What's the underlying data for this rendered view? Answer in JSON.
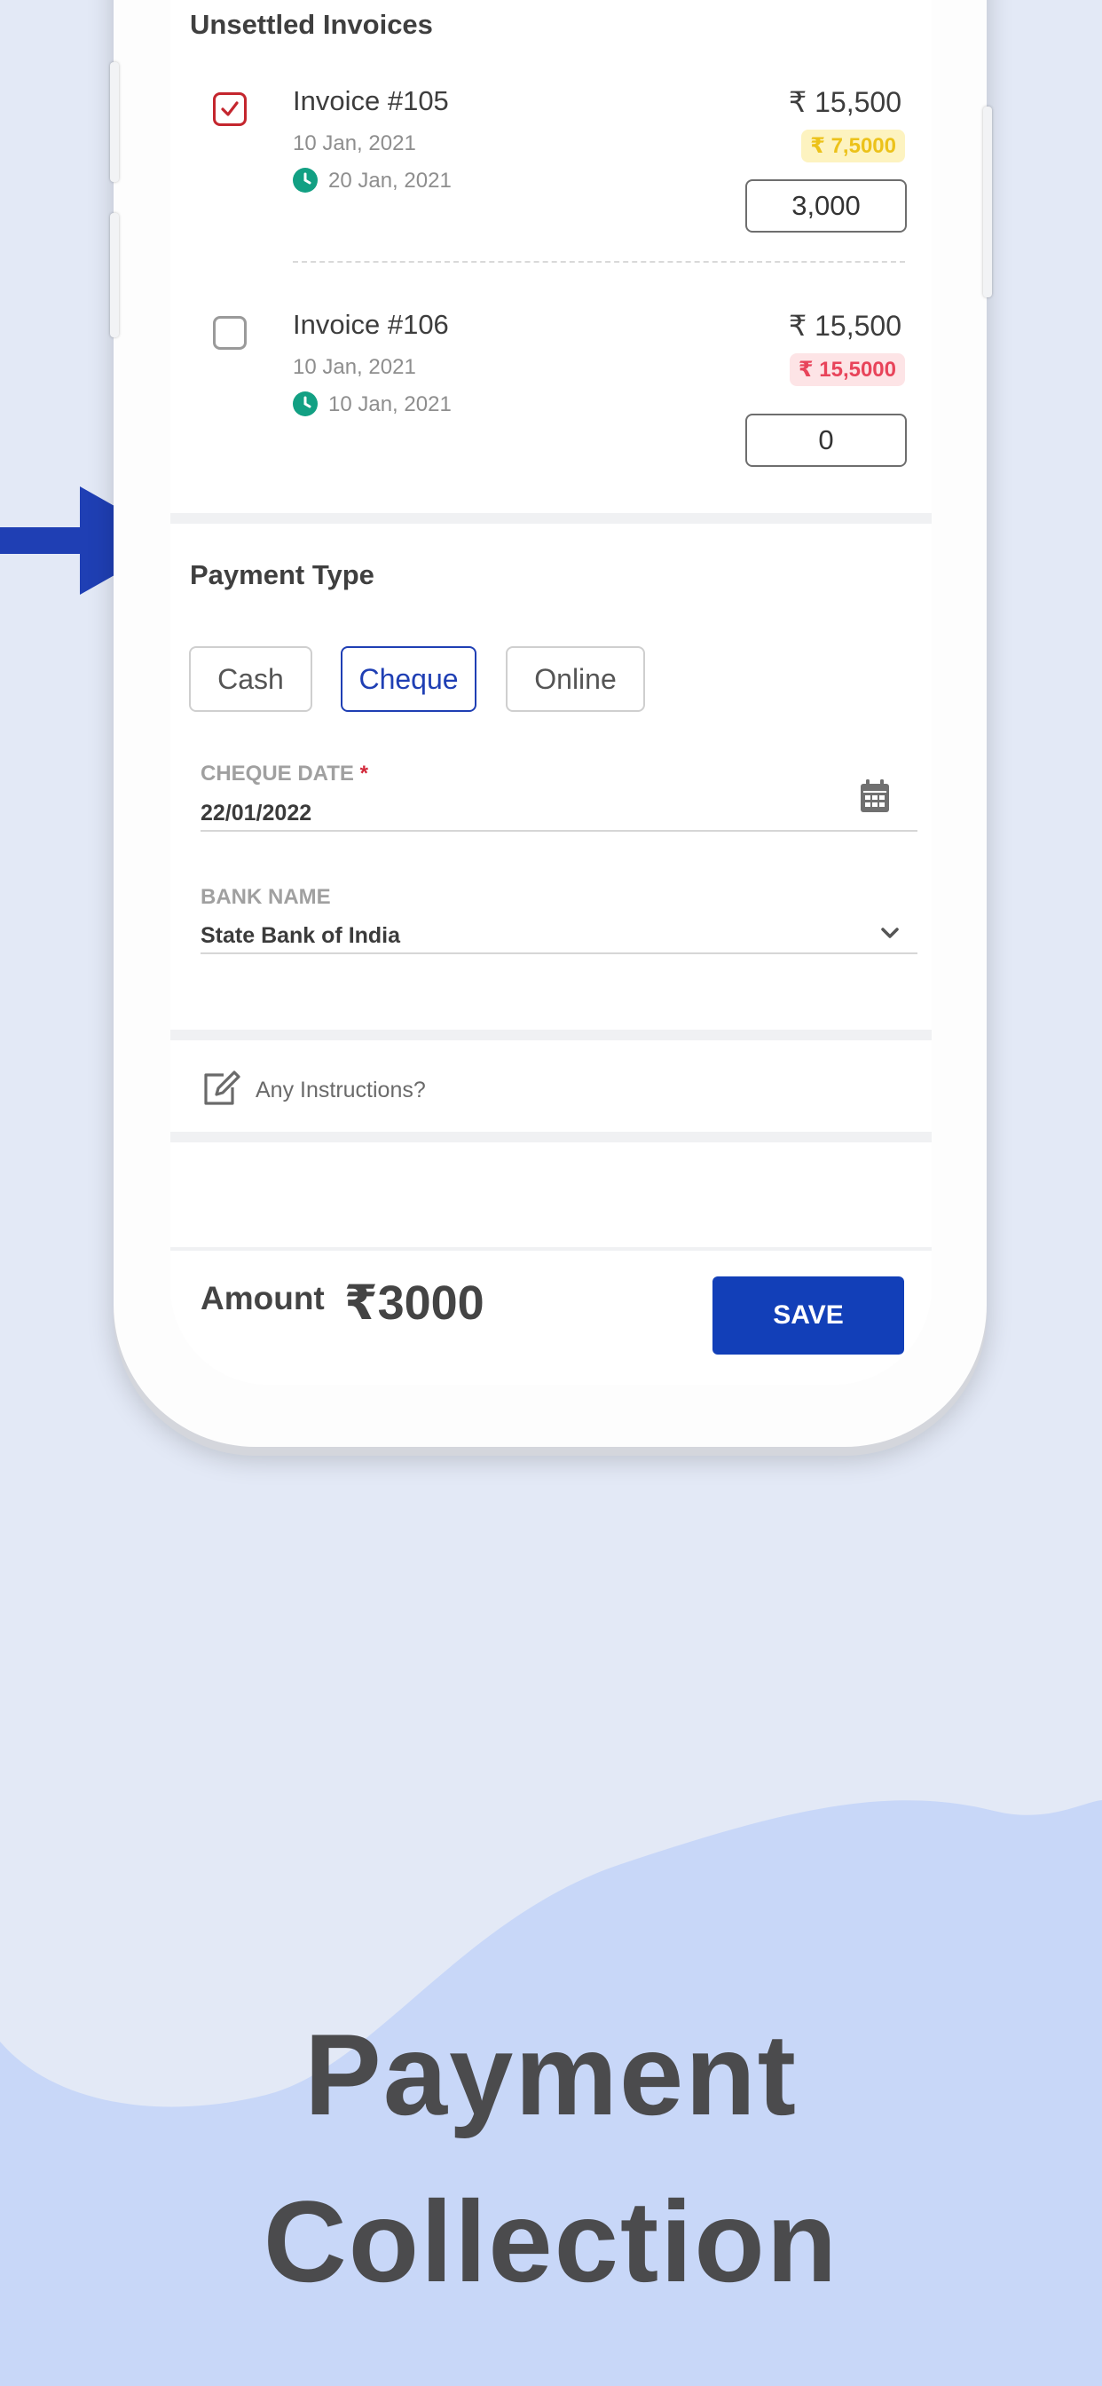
{
  "section": {
    "unsettled_title": "Unsettled Invoices",
    "payment_type_title": "Payment Type"
  },
  "invoices": [
    {
      "title": "Invoice  #105",
      "date": "10 Jan, 2021",
      "due_date": "20 Jan, 2021",
      "amount": "₹ 15,500",
      "pending": "₹ 7,5000",
      "pending_color": "#ecc21a",
      "input_value": "3,000",
      "checked": true
    },
    {
      "title": "Invoice  #106",
      "date": "10 Jan, 2021",
      "due_date": "10 Jan, 2021",
      "amount": "₹ 15,500",
      "pending": "₹ 15,5000",
      "pending_color": "#e8445a",
      "input_value": "0",
      "checked": false
    }
  ],
  "payment_types": [
    {
      "label": "Cash",
      "active": false
    },
    {
      "label": "Cheque",
      "active": true
    },
    {
      "label": "Online",
      "active": false
    }
  ],
  "cheque_date": {
    "label": "CHEQUE DATE",
    "required_mark": "*",
    "value": "22/01/2022",
    "icon": "calendar-icon"
  },
  "bank_name": {
    "label": "BANK NAME",
    "value": "State Bank of India",
    "icon": "chevron-down-icon"
  },
  "instructions": {
    "placeholder": "Any Instructions?",
    "icon": "edit-icon"
  },
  "footer": {
    "amount_label": "Amount",
    "amount_value": "₹3000",
    "save_label": "SAVE"
  },
  "headline": {
    "line1": "Payment",
    "line2": "Collection"
  },
  "colors": {
    "accent": "#1f3fb4",
    "save_button": "#123fb8",
    "checkbox_checked": "#c4262e",
    "due_clock": "#12a083",
    "background": "#e3e9f6",
    "wave": "#c8d7f8"
  }
}
